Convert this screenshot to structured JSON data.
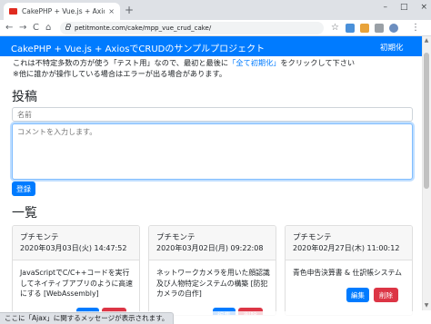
{
  "browser": {
    "tab_title": "CakePHP + Vue.js + Axiosで",
    "tab_close": "×",
    "new_tab": "+",
    "url": "petitmonte.com/cake/mpp_vue_crud_cake/",
    "back": "←",
    "forward": "→",
    "reload": "C",
    "home": "⌂",
    "minimize": "–",
    "maximize": "□",
    "close": "×",
    "star": "☆",
    "menu": "⋮"
  },
  "navbar": {
    "brand": "CakePHP + Vue.js + AxiosでCRUDのサンプルプロジェクト",
    "init_link": "初期化",
    "color": "#007bff"
  },
  "notice": {
    "line1_before": "これは不特定多数の方が使う「テスト用」なので、最初と最後に",
    "line1_link": "「全て初期化」",
    "line1_after": "をクリックして下さい",
    "line2": "※他に誰かが操作している場合はエラーが出る場合があります。"
  },
  "form": {
    "heading": "投稿",
    "name_placeholder": "名前",
    "comment_placeholder": "コメントを入力します。",
    "submit_label": "登録"
  },
  "list": {
    "heading": "一覧",
    "edit_label": "編集",
    "delete_label": "削除",
    "items": [
      {
        "author": "プチモンテ",
        "date": "2020年03月03日(火) 14:47:52",
        "text": "JavaScriptでC/C++コードを実行してネイティブアプリのように高速にする [WebAssembly]"
      },
      {
        "author": "プチモンテ",
        "date": "2020年03月02日(月) 09:22:08",
        "text": "ネットワークカメラを用いた顔認識及び人物特定システムの構築 [防犯カメラの自作]"
      },
      {
        "author": "プチモンテ",
        "date": "2020年02月27日(木) 11:00:12",
        "text": "青色申告決算書 & 仕訳帳システム"
      }
    ]
  },
  "status": {
    "text": "ここに「Ajax」に関するメッセージが表示されます。"
  },
  "colors": {
    "primary": "#007bff",
    "danger": "#dc3545"
  }
}
